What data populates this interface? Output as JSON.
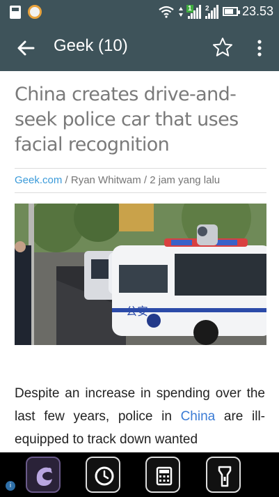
{
  "status_bar": {
    "time": "23.53",
    "sim1_badge": "1",
    "sim2_badge": "2"
  },
  "app_bar": {
    "title": "Geek (10)"
  },
  "article": {
    "headline": "China creates drive-and-seek police car that uses facial recognition",
    "source": "Geek.com",
    "separator1": " / ",
    "author": "Ryan Whitwam",
    "separator2": " / ",
    "time_ago": "2 jam yang lalu",
    "photo_sign": "公安",
    "body_part1": "Despite an increase in spending over the last few years, police in ",
    "body_link": "China",
    "body_part2": " are ill-equipped to track down wanted"
  },
  "colors": {
    "app_bar": "#3e535a",
    "link": "#3a9ad9",
    "fab": "#f9b531"
  },
  "icons": {
    "back": "arrow-left-icon",
    "star": "star-outline-icon",
    "more": "more-vertical-icon",
    "share": "share-icon",
    "dock": [
      "uc-browser-icon",
      "clock-icon",
      "calculator-icon",
      "flashlight-icon"
    ]
  }
}
